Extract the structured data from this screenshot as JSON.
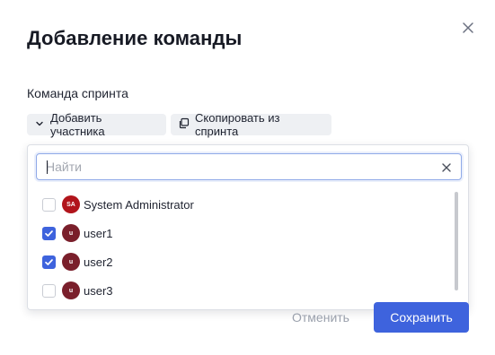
{
  "dialog": {
    "title": "Добавление команды",
    "section_label": "Команда спринта"
  },
  "actions": {
    "add_member_label": "Добавить участника",
    "copy_from_sprint_label": "Скопировать из спринта"
  },
  "search": {
    "placeholder": "Найти",
    "value": ""
  },
  "users": [
    {
      "name": "System Administrator",
      "initials": "SA",
      "checked": false
    },
    {
      "name": "user1",
      "initials": "u",
      "checked": true
    },
    {
      "name": "user2",
      "initials": "u",
      "checked": true
    },
    {
      "name": "user3",
      "initials": "u",
      "checked": false
    }
  ],
  "footer": {
    "cancel_label": "Отменить",
    "save_label": "Сохранить"
  },
  "colors": {
    "accent": "#3e63dd",
    "avatar_sa": "#b1141b",
    "avatar_user": "#7a1f2b"
  },
  "icons": {
    "close": "close-icon",
    "add": "chevron-down-icon",
    "copy": "copy-icon",
    "clear": "clear-icon",
    "check": "checkmark-icon"
  }
}
